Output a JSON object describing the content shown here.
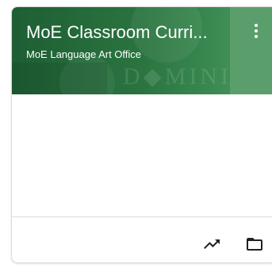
{
  "course_card": {
    "title": "MoE Classroom Curri...",
    "section": "MoE Language Art Office",
    "header_color": "#2a7440"
  },
  "icons": {
    "more": "more-vert-icon",
    "gradebook": "trending-up-icon",
    "folder": "folder-icon"
  }
}
